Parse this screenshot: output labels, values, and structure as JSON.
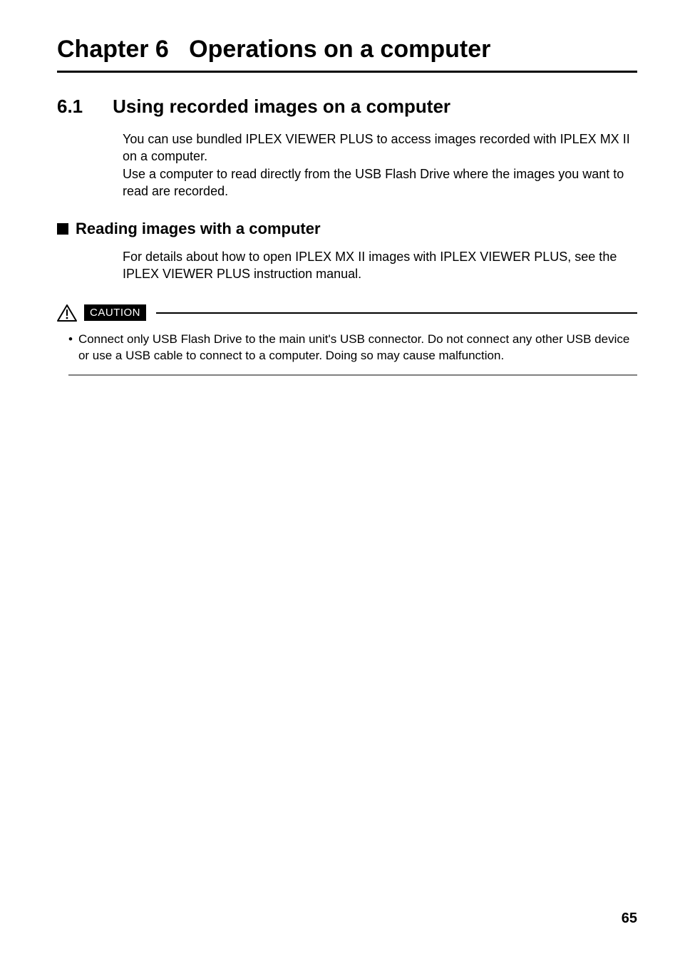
{
  "chapter": {
    "label": "Chapter 6",
    "title": "Operations on a computer"
  },
  "section": {
    "number": "6.1",
    "title": "Using recorded images on a computer",
    "body_line1": "You can use bundled IPLEX VIEWER PLUS to access images recorded with IPLEX MX II on a computer.",
    "body_line2": "Use a computer to read directly from the USB Flash Drive where the images you want to read are recorded."
  },
  "subsection": {
    "title": "Reading images with a computer",
    "body": "For details about how to open IPLEX MX II images with IPLEX VIEWER PLUS, see the IPLEX VIEWER PLUS instruction manual."
  },
  "caution": {
    "label": "CAUTION",
    "bullet": "•",
    "text": "Connect only USB Flash Drive to the main unit's USB connector. Do not connect any other USB device or use a USB cable to connect to a computer. Doing so may cause malfunction."
  },
  "page_number": "65"
}
